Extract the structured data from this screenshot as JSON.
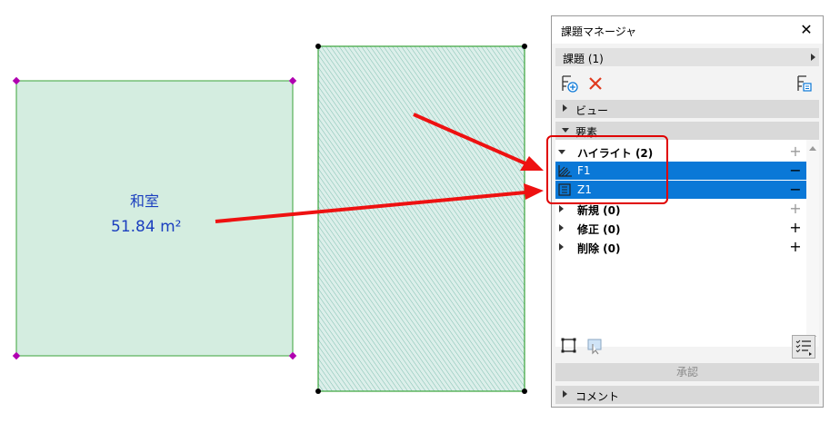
{
  "panel": {
    "title": "課題マネージャ",
    "issues_dropdown": "課題 (1)",
    "sections": {
      "view_label": "ビュー",
      "elements_label": "要素",
      "comment_label": "コメント"
    },
    "tree": [
      {
        "label": "ハイライト (2)",
        "action": "+",
        "expanded": true,
        "selected": false,
        "kind": "group"
      },
      {
        "label": "F1",
        "action": "−",
        "selected": true,
        "kind": "item",
        "icon": "fill-element-icon"
      },
      {
        "label": "Z1",
        "action": "−",
        "selected": true,
        "kind": "item",
        "icon": "zone-element-icon"
      },
      {
        "label": "新規 (0)",
        "action": "+",
        "expanded": false,
        "selected": false,
        "kind": "group"
      },
      {
        "label": "修正 (0)",
        "action": "+",
        "expanded": false,
        "selected": false,
        "kind": "group"
      },
      {
        "label": "削除 (0)",
        "action": "+",
        "expanded": false,
        "selected": false,
        "kind": "group"
      }
    ],
    "approve_label": "承認",
    "close_glyph": "✕"
  },
  "room": {
    "name": "和室",
    "area": "51.84 m²"
  },
  "colors": {
    "selection": "#0a78d7",
    "room_fill": "#d4ede0",
    "callout": "#ee1111"
  }
}
